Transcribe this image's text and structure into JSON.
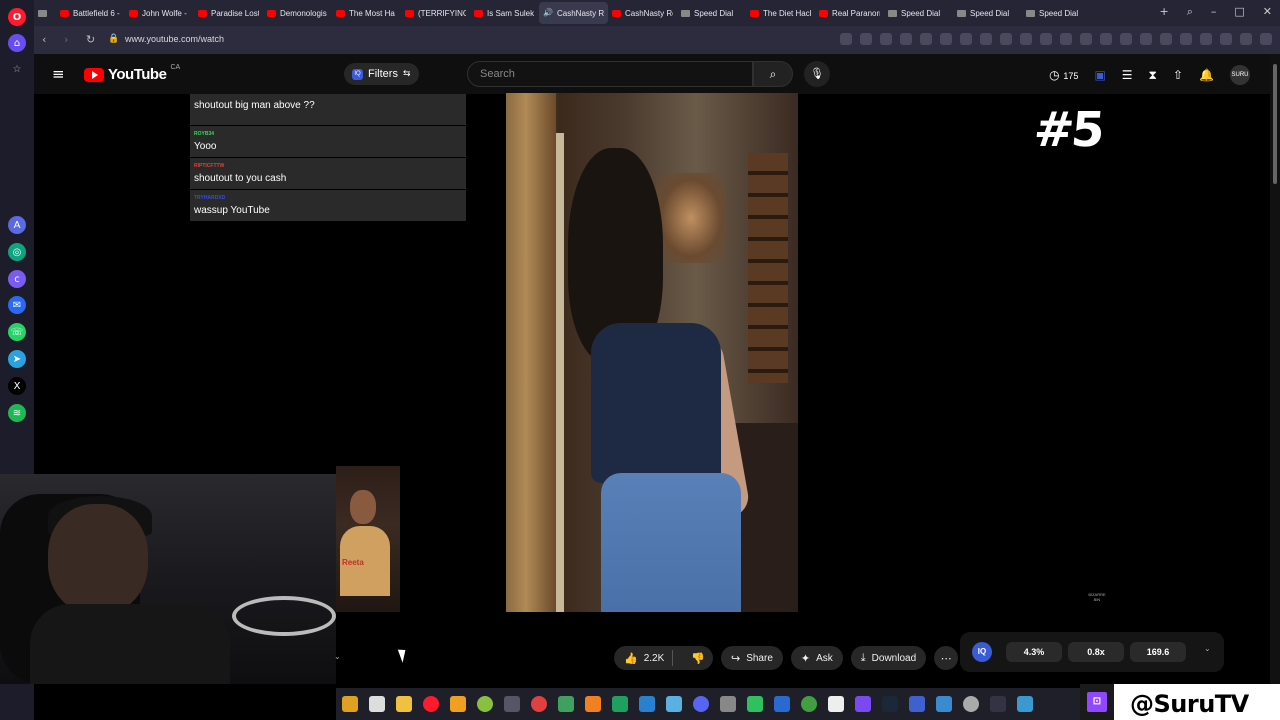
{
  "browser": {
    "tabs": [
      {
        "label": "Battlefield 6 -",
        "favicon": "youtube-icon"
      },
      {
        "label": "John Wolfe -",
        "favicon": "youtube-icon"
      },
      {
        "label": "Paradise Lost",
        "favicon": "youtube-icon"
      },
      {
        "label": "Demonologis",
        "favicon": "youtube-icon"
      },
      {
        "label": "The Most Ha",
        "favicon": "youtube-icon"
      },
      {
        "label": "(TERRIFYING)",
        "favicon": "youtube-icon"
      },
      {
        "label": "Is Sam Sulek",
        "favicon": "youtube-icon"
      },
      {
        "label": "CashNasty Reacts",
        "favicon": "speaker-icon",
        "active": true
      },
      {
        "label": "CashNasty Re",
        "favicon": "youtube-icon"
      },
      {
        "label": "Speed Dial",
        "favicon": "speed-dial-icon"
      },
      {
        "label": "The Diet Hack",
        "favicon": "youtube-icon"
      },
      {
        "label": "Real Paranorm",
        "favicon": "youtube-icon"
      },
      {
        "label": "Speed Dial",
        "favicon": "speed-dial-icon"
      },
      {
        "label": "Speed Dial",
        "favicon": "speed-dial-icon"
      },
      {
        "label": "Speed Dial",
        "favicon": "speed-dial-icon"
      }
    ],
    "url": "www.youtube.com/watch"
  },
  "youtube": {
    "logo_text": "YouTube",
    "country_code": "CA",
    "filters_label": "Filters",
    "filters_badge": "IQ",
    "search_placeholder": "Search",
    "counter": "175",
    "avatar_text": "SURU"
  },
  "chat": [
    {
      "user": "",
      "text": "shoutout big man above ??",
      "color": "#ffffff"
    },
    {
      "user": "ROYB34",
      "text": "Yooo",
      "color": "#3ad65a"
    },
    {
      "user": "RIPTICFTTW",
      "text": "shoutout to you cash",
      "color": "#e0403a"
    },
    {
      "user": "TRYHARDXD",
      "text": "wassup YouTube",
      "color": "#3a4ae0"
    }
  ],
  "video": {
    "rank_label": "#5",
    "watermark": "BIZARRE BIN"
  },
  "actions": {
    "like_count": "2.2K",
    "share_label": "Share",
    "ask_label": "Ask",
    "download_label": "Download"
  },
  "extension": {
    "logo": "IQ",
    "stat_1": "4.3%",
    "stat_2": "0.8x",
    "stat_3": "169.6"
  },
  "overlay": {
    "handle": "@SuruTV",
    "webcam_shirt_text": "Reeta"
  },
  "colors": {
    "youtube_red": "#ff0000",
    "opera_red": "#ff1b2d",
    "twitch_purple": "#9146ff",
    "iq_blue": "#3a5bd6"
  }
}
